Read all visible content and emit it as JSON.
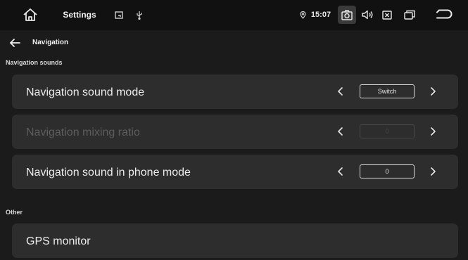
{
  "statusbar": {
    "title": "Settings",
    "time": "15:07",
    "icons": [
      "home-icon",
      "screen-icon",
      "usb-icon",
      "location-icon",
      "screenshot-icon",
      "volume-icon",
      "close-app-icon",
      "window-icon",
      "return-icon"
    ]
  },
  "nav": {
    "title": "Navigation"
  },
  "sections": {
    "sounds_title": "Navigation sounds",
    "other_title": "Other"
  },
  "rows": [
    {
      "label": "Navigation sound mode",
      "value": "Switch",
      "enabled": true
    },
    {
      "label": "Navigation mixing ratio",
      "value": "0",
      "enabled": false
    },
    {
      "label": "Navigation sound in phone mode",
      "value": "0",
      "enabled": true
    }
  ],
  "other": {
    "gps_label": "GPS monitor"
  },
  "colors": {
    "background": "#1b1b1b",
    "statusbar": "#111111",
    "row": "#2d2d2d",
    "disabled_text": "#5d5d5d"
  }
}
